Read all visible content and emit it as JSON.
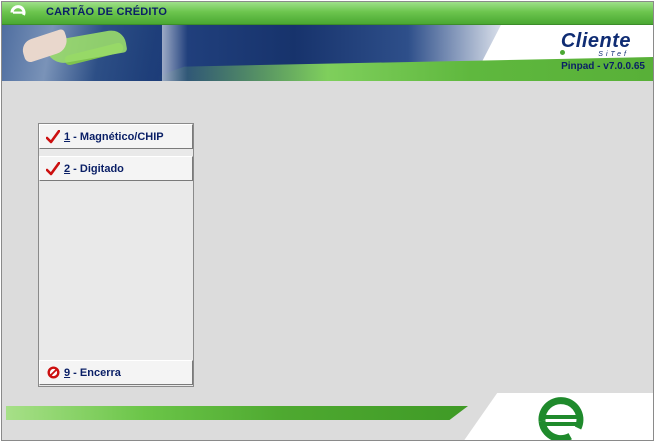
{
  "window": {
    "title": "CARTÃO DE CRÉDITO"
  },
  "header": {
    "brand": "Cliente",
    "brand_sub": "SiTef",
    "version": "Pinpad - v7.0.0.65"
  },
  "menu": {
    "items": [
      {
        "icon": "check-icon",
        "number": "1",
        "text": " - Magnético/CHIP"
      },
      {
        "icon": "check-icon",
        "number": "2",
        "text": " - Digitado"
      }
    ],
    "exit": {
      "icon": "stop-icon",
      "number": "9",
      "text": " - Encerra"
    }
  },
  "colors": {
    "title_text": "#0a1f66",
    "accent_green": "#4aa832",
    "check_red": "#cc1010",
    "background": "#dcdcdc"
  }
}
